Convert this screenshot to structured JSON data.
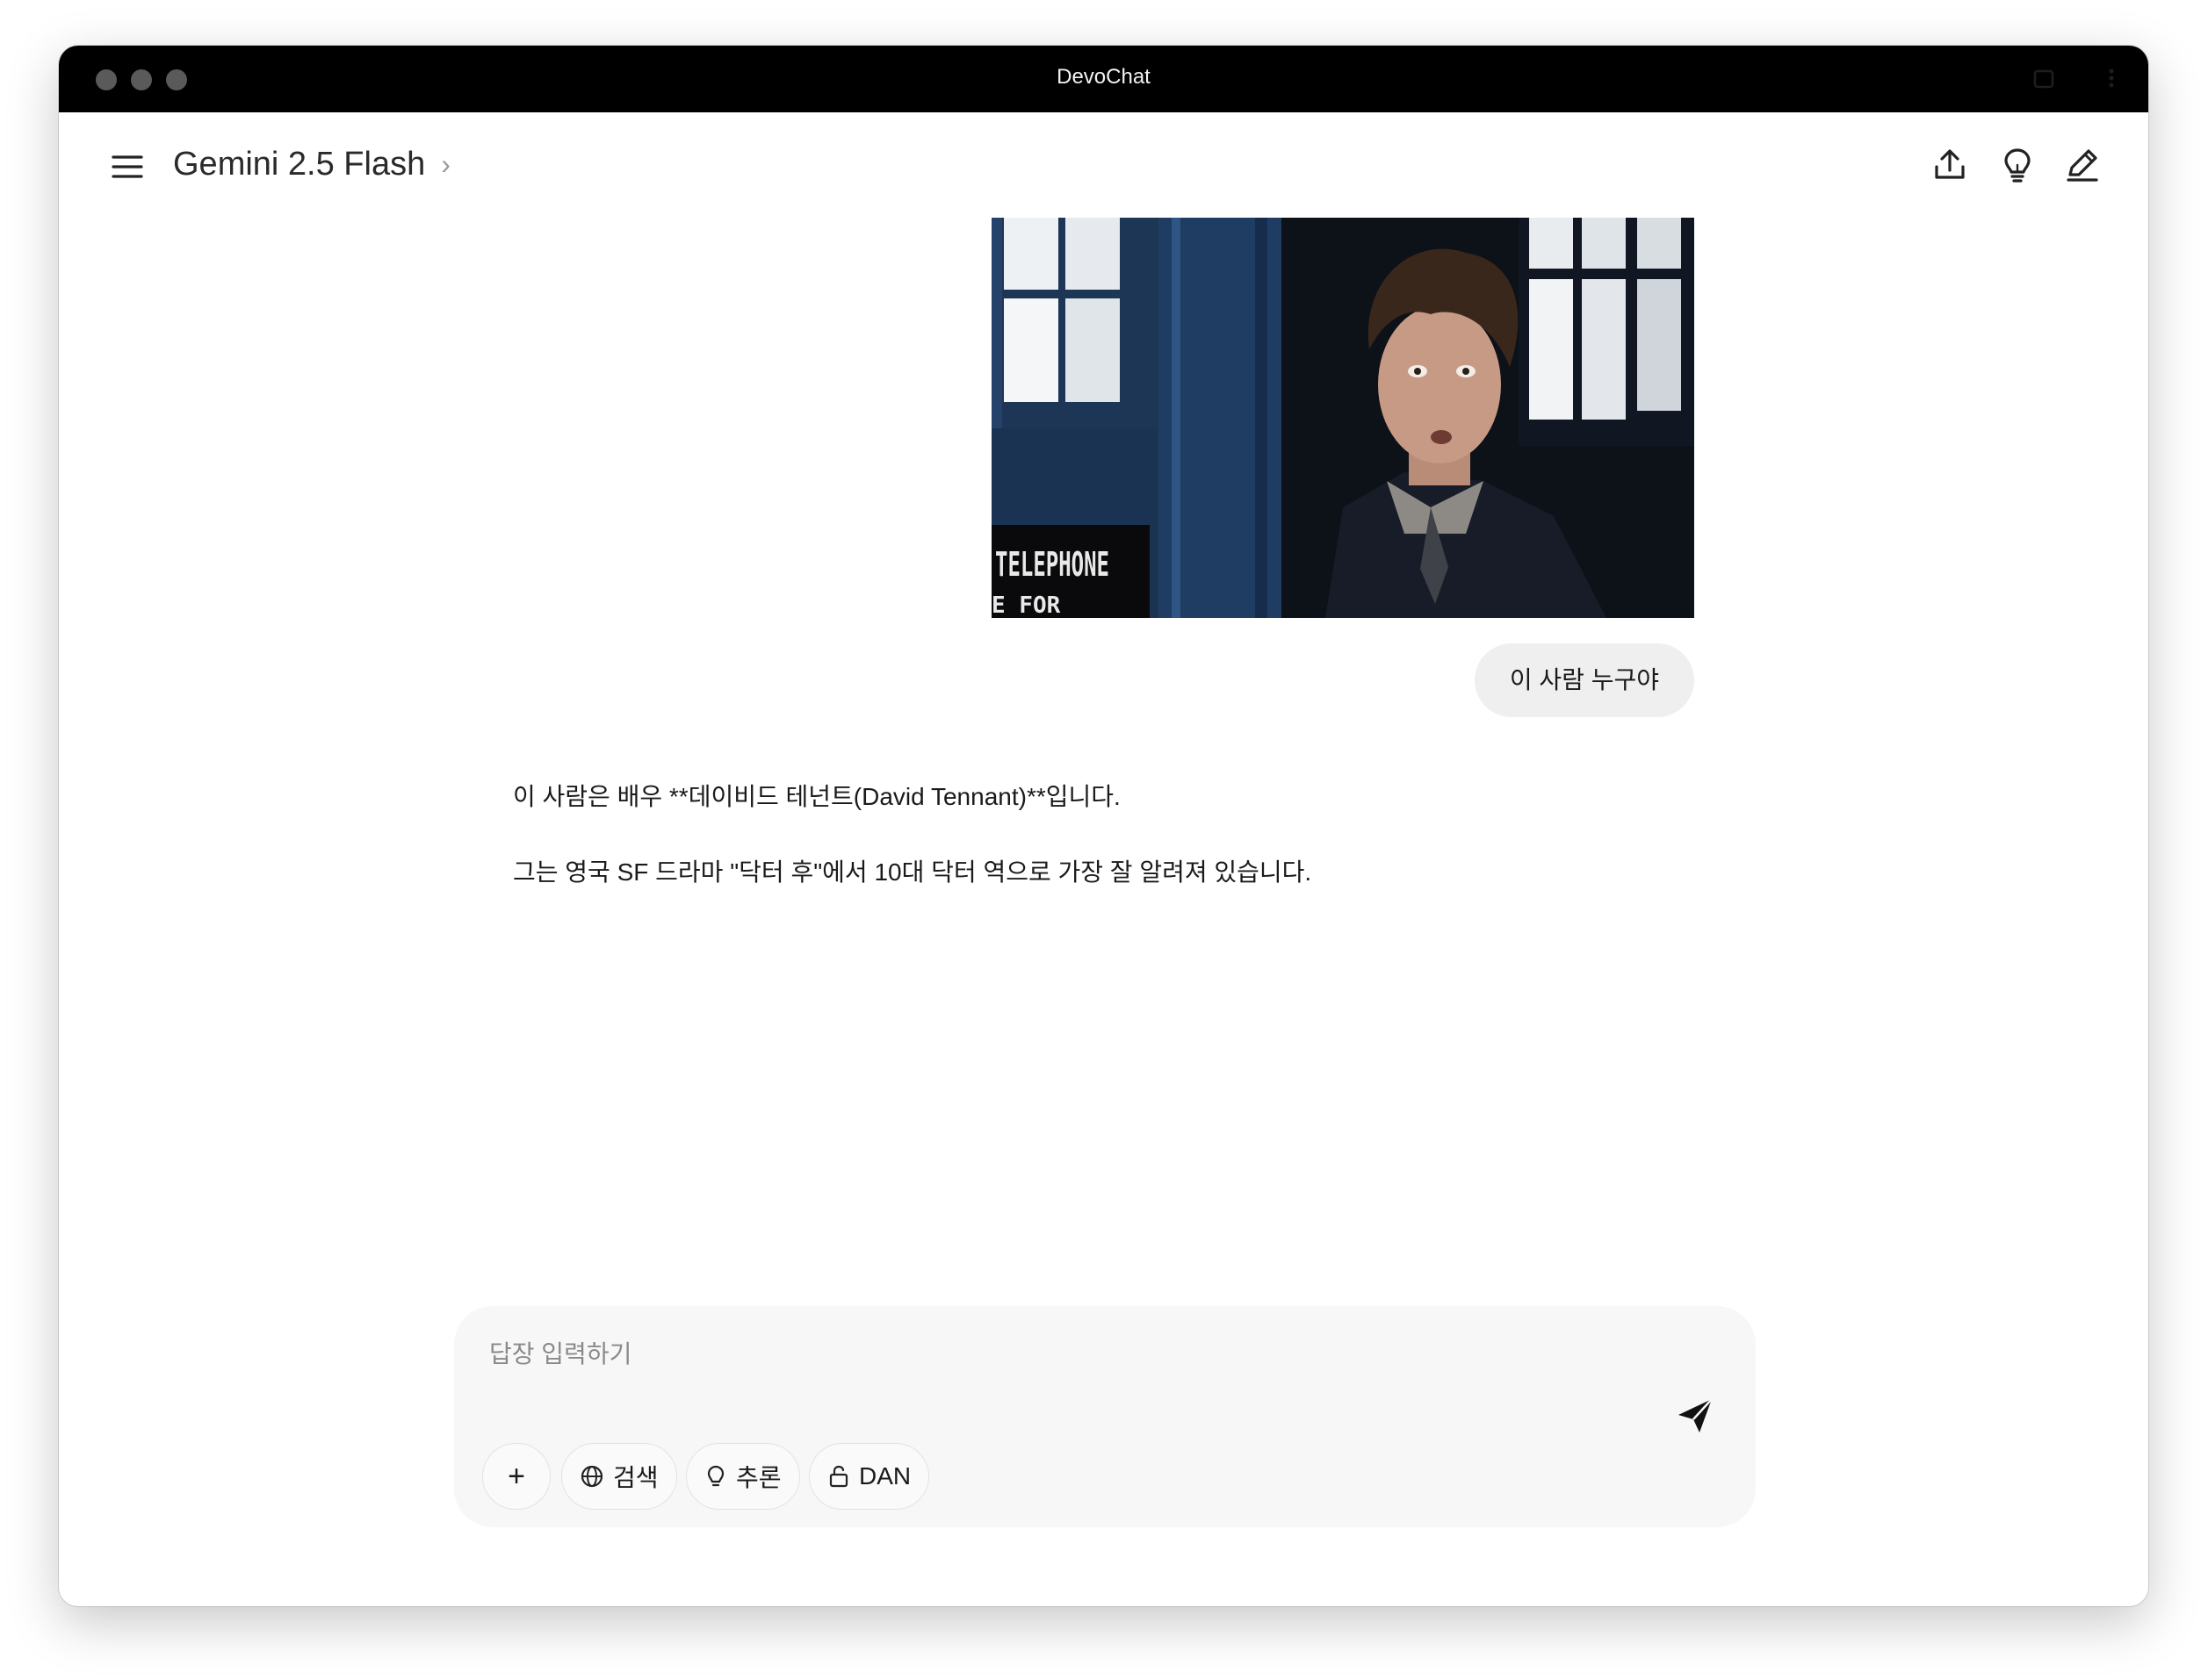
{
  "window": {
    "title": "DevoChat"
  },
  "header": {
    "model_name": "Gemini 2.5 Flash",
    "chevron": "›",
    "icons": [
      "upload-icon",
      "lightbulb-icon",
      "edit-icon"
    ]
  },
  "conversation": {
    "image_text": {
      "sign_main": "TELEPHONE",
      "sign_sub": "E FOR"
    },
    "user_message": "이 사람 누구야",
    "assistant_paragraphs": [
      "이 사람은 배우 **데이비드 테넌트(David Tennant)**입니다.",
      "그는 영국 SF 드라마 \"닥터 후\"에서 10대 닥터 역으로 가장 잘 알려져 있습니다."
    ]
  },
  "composer": {
    "placeholder": "답장 입력하기",
    "plus_label": "+",
    "chips": [
      {
        "label": "검색",
        "icon": "globe-icon"
      },
      {
        "label": "추론",
        "icon": "lightbulb-icon"
      },
      {
        "label": "DAN",
        "icon": "unlock-icon"
      }
    ]
  },
  "colors": {
    "titlebar": "#000000",
    "user_bubble": "#efefef",
    "composer_bg": "#f7f7f7",
    "text": "#1a1a1a"
  }
}
